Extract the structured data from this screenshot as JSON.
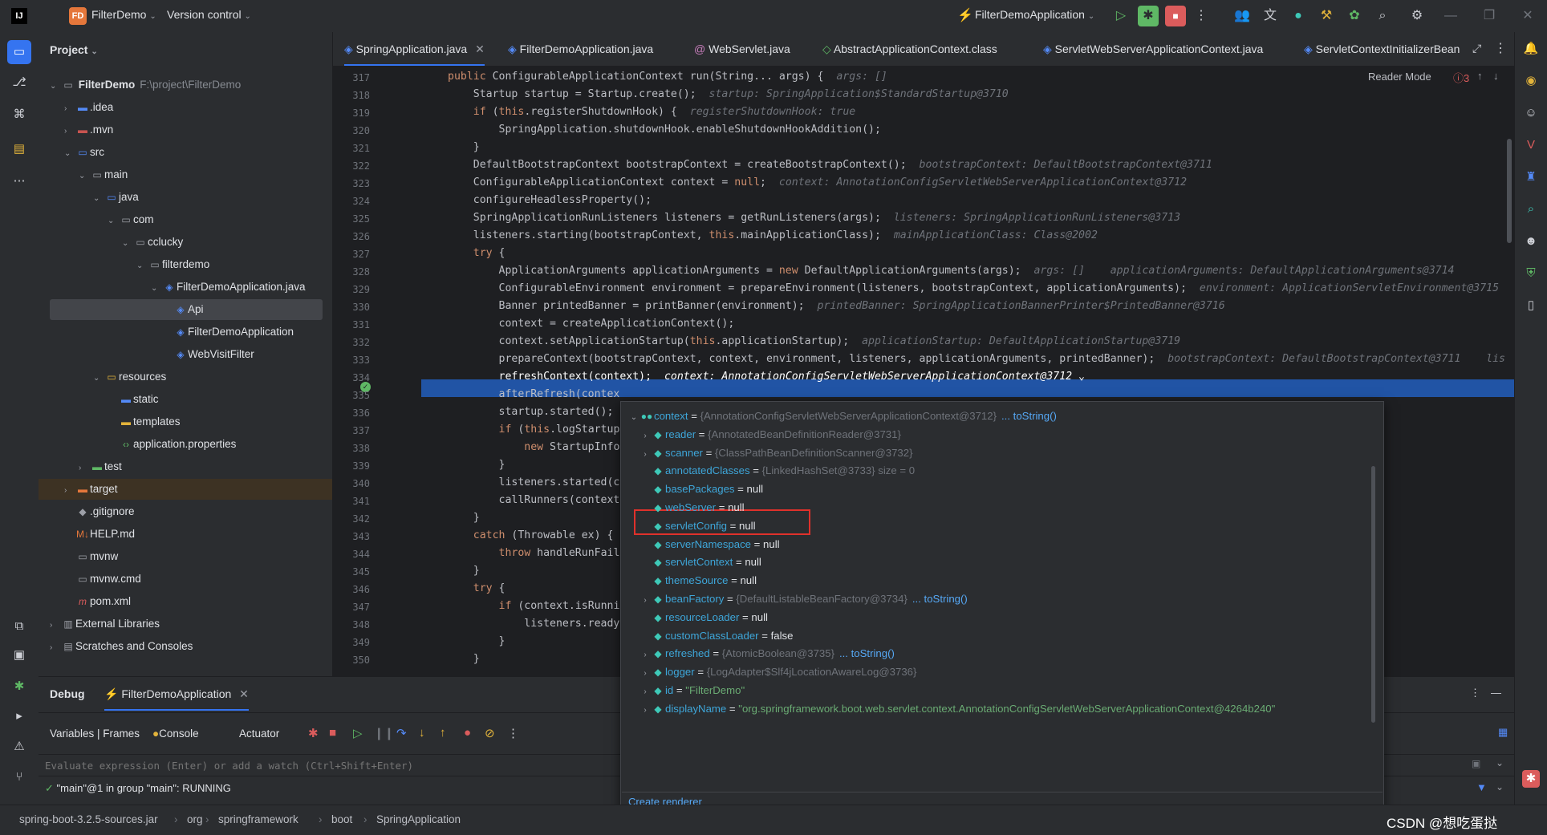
{
  "titlebar": {
    "project_badge": "FD",
    "project_name": "FilterDemo",
    "vcs": "Version control",
    "run_config": "FilterDemoApplication"
  },
  "project_panel": {
    "title": "Project",
    "root_name": "FilterDemo",
    "root_path": "F:\\project\\FilterDemo",
    "items": [
      {
        "label": ".idea",
        "icon": "folder-icon"
      },
      {
        "label": ".mvn",
        "icon": "folder-icon"
      },
      {
        "label": "src",
        "icon": "folder-icon"
      },
      {
        "label": "main",
        "icon": "folder-icon"
      },
      {
        "label": "java",
        "icon": "folder-icon"
      },
      {
        "label": "com",
        "icon": "package-icon"
      },
      {
        "label": "cclucky",
        "icon": "package-icon"
      },
      {
        "label": "filterdemo",
        "icon": "package-icon"
      },
      {
        "label": "FilterDemoApplication.java",
        "icon": "java-file-icon"
      },
      {
        "label": "Api",
        "icon": "class-icon"
      },
      {
        "label": "FilterDemoApplication",
        "icon": "class-icon"
      },
      {
        "label": "WebVisitFilter",
        "icon": "class-icon"
      },
      {
        "label": "resources",
        "icon": "folder-icon"
      },
      {
        "label": "static",
        "icon": "folder-icon"
      },
      {
        "label": "templates",
        "icon": "folder-icon"
      },
      {
        "label": "application.properties",
        "icon": "properties-icon"
      },
      {
        "label": "test",
        "icon": "folder-icon"
      },
      {
        "label": "target",
        "icon": "folder-icon"
      },
      {
        "label": ".gitignore",
        "icon": "git-icon"
      },
      {
        "label": "HELP.md",
        "icon": "markdown-icon"
      },
      {
        "label": "mvnw",
        "icon": "file-icon"
      },
      {
        "label": "mvnw.cmd",
        "icon": "file-icon"
      },
      {
        "label": "pom.xml",
        "icon": "maven-icon"
      },
      {
        "label": "External Libraries",
        "icon": "library-icon"
      },
      {
        "label": "Scratches and Consoles",
        "icon": "scratch-icon"
      }
    ]
  },
  "tabs": [
    {
      "label": "SpringApplication.java"
    },
    {
      "label": "FilterDemoApplication.java"
    },
    {
      "label": "WebServlet.java"
    },
    {
      "label": "AbstractApplicationContext.class"
    },
    {
      "label": "ServletWebServerApplicationContext.java"
    },
    {
      "label": "ServletContextInitializerBean"
    }
  ],
  "editor": {
    "reader_mode": "Reader Mode",
    "problems_count": "3",
    "line_numbers": [
      "317",
      "318",
      "319",
      "320",
      "321",
      "322",
      "323",
      "324",
      "325",
      "326",
      "327",
      "328",
      "329",
      "330",
      "331",
      "332",
      "333",
      "334",
      "335",
      "336",
      "337",
      "338",
      "339",
      "340",
      "341",
      "342",
      "343",
      "344",
      "345",
      "346",
      "347",
      "348",
      "349",
      "350"
    ],
    "lines": [
      {
        "code": "public ConfigurableApplicationContext run(String... args) {",
        "hint": "args: []"
      },
      {
        "code": "    Startup startup = Startup.create();",
        "hint": "startup: SpringApplication$StandardStartup@3710"
      },
      {
        "code": "    if (this.registerShutdownHook) {",
        "hint": "registerShutdownHook: true"
      },
      {
        "code": "        SpringApplication.shutdownHook.enableShutdownHookAddition();",
        "hint": ""
      },
      {
        "code": "    }",
        "hint": ""
      },
      {
        "code": "    DefaultBootstrapContext bootstrapContext = createBootstrapContext();",
        "hint": "bootstrapContext: DefaultBootstrapContext@3711"
      },
      {
        "code": "    ConfigurableApplicationContext context = null;",
        "hint": "context: AnnotationConfigServletWebServerApplicationContext@3712"
      },
      {
        "code": "    configureHeadlessProperty();",
        "hint": ""
      },
      {
        "code": "    SpringApplicationRunListeners listeners = getRunListeners(args);",
        "hint": "listeners: SpringApplicationRunListeners@3713"
      },
      {
        "code": "    listeners.starting(bootstrapContext, this.mainApplicationClass);",
        "hint": "mainApplicationClass: Class@2002"
      },
      {
        "code": "    try {",
        "hint": ""
      },
      {
        "code": "        ApplicationArguments applicationArguments = new DefaultApplicationArguments(args);",
        "hint": "args: []    applicationArguments: DefaultApplicationArguments@3714"
      },
      {
        "code": "        ConfigurableEnvironment environment = prepareEnvironment(listeners, bootstrapContext, applicationArguments);",
        "hint": "environment: ApplicationServletEnvironment@3715"
      },
      {
        "code": "        Banner printedBanner = printBanner(environment);",
        "hint": "printedBanner: SpringApplicationBannerPrinter$PrintedBanner@3716"
      },
      {
        "code": "        context = createApplicationContext();",
        "hint": ""
      },
      {
        "code": "        context.setApplicationStartup(this.applicationStartup);",
        "hint": "applicationStartup: DefaultApplicationStartup@3719"
      },
      {
        "code": "        prepareContext(bootstrapContext, context, environment, listeners, applicationArguments, printedBanner);",
        "hint": "bootstrapContext: DefaultBootstrapContext@3711    lis"
      },
      {
        "code": "        refreshContext(context);",
        "hint": "context: AnnotationConfigServletWebServerApplicationContext@3712 ⌄"
      },
      {
        "code": "        afterRefresh(contex",
        "hint": ""
      },
      {
        "code": "        startup.started();",
        "hint": ""
      },
      {
        "code": "        if (this.logStartup",
        "hint": ""
      },
      {
        "code": "            new StartupInfo",
        "hint": ""
      },
      {
        "code": "        }",
        "hint": ""
      },
      {
        "code": "        listeners.started(c",
        "hint": ""
      },
      {
        "code": "        callRunners(context",
        "hint": ""
      },
      {
        "code": "    }",
        "hint": ""
      },
      {
        "code": "    catch (Throwable ex) {",
        "hint": ""
      },
      {
        "code": "        throw handleRunFail",
        "hint": ""
      },
      {
        "code": "    }",
        "hint": ""
      },
      {
        "code": "    try {",
        "hint": ""
      },
      {
        "code": "        if (context.isRunni",
        "hint": ""
      },
      {
        "code": "            listeners.ready",
        "hint": ""
      },
      {
        "code": "        }",
        "hint": ""
      },
      {
        "code": "    }",
        "hint": ""
      }
    ]
  },
  "popup": {
    "rows": [
      {
        "name": "context",
        "eq": " = ",
        "value": "{AnnotationConfigServletWebServerApplicationContext@3712}",
        "link": "... toString()"
      },
      {
        "name": "reader",
        "eq": " = ",
        "value": "{AnnotatedBeanDefinitionReader@3731}",
        "link": ""
      },
      {
        "name": "scanner",
        "eq": " = ",
        "value": "{ClassPathBeanDefinitionScanner@3732}",
        "link": ""
      },
      {
        "name": "annotatedClasses",
        "eq": " = ",
        "value": "{LinkedHashSet@3733}  size = 0",
        "link": ""
      },
      {
        "name": "basePackages",
        "eq": " = ",
        "value": "null",
        "link": ""
      },
      {
        "name": "webServer",
        "eq": " = ",
        "value": "null",
        "link": ""
      },
      {
        "name": "servletConfig",
        "eq": " = ",
        "value": "null",
        "link": ""
      },
      {
        "name": "serverNamespace",
        "eq": " = ",
        "value": "null",
        "link": ""
      },
      {
        "name": "servletContext",
        "eq": " = ",
        "value": "null",
        "link": ""
      },
      {
        "name": "themeSource",
        "eq": " = ",
        "value": "null",
        "link": ""
      },
      {
        "name": "beanFactory",
        "eq": " = ",
        "value": "{DefaultListableBeanFactory@3734}",
        "link": "... toString()"
      },
      {
        "name": "resourceLoader",
        "eq": " = ",
        "value": "null",
        "link": ""
      },
      {
        "name": "customClassLoader",
        "eq": " = ",
        "value": "false",
        "link": ""
      },
      {
        "name": "refreshed",
        "eq": " = ",
        "value": "{AtomicBoolean@3735}",
        "link": "... toString()"
      },
      {
        "name": "logger",
        "eq": " = ",
        "value": "{LogAdapter$Slf4jLocationAwareLog@3736}",
        "link": ""
      },
      {
        "name": "id",
        "eq": " = ",
        "value": "\"FilterDemo\"",
        "link": ""
      },
      {
        "name": "displayName",
        "eq": " = ",
        "value": "\"org.springframework.boot.web.servlet.context.AnnotationConfigServletWebServerApplicationContext@4264b240\"",
        "link": ""
      }
    ],
    "footer": "Create renderer"
  },
  "debug": {
    "title": "Debug",
    "session": "FilterDemoApplication",
    "tabs": [
      "Variables | Frames",
      "Console",
      "Actuator"
    ],
    "eval_placeholder": "Evaluate expression (Enter) or add a watch (Ctrl+Shift+Enter)",
    "thread": "\"main\"@1 in group \"main\": RUNNING"
  },
  "statusbar": {
    "crumbs": [
      "spring-boot-3.2.5-sources.jar",
      "org",
      "springframework",
      "boot",
      "SpringApplication"
    ],
    "watermark": "CSDN @想吃蛋挞"
  },
  "colors": {
    "accent": "#3574f0",
    "exec_line": "#2154a5",
    "highlight": "#e0312b"
  }
}
